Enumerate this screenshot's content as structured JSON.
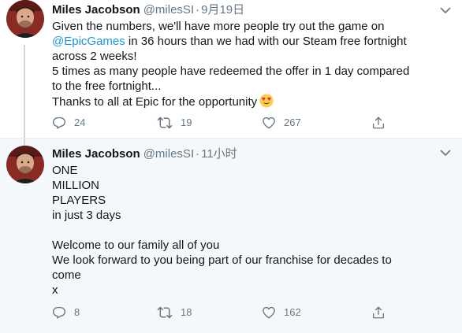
{
  "tweets": [
    {
      "author": {
        "name": "Miles Jacobson",
        "handle": "@milesSI"
      },
      "separator": "·",
      "time": "9月19日",
      "text_lines": [
        "Given the numbers, we'll have more people try out the game on",
        " in 36 hours than we had with our Steam free fortnight",
        "across 2 weeks!",
        "5 times as many people have redeemed the offer in 1 day compared",
        "to the free fortnight...",
        "Thanks to all at Epic for the opportunity"
      ],
      "mention": "@EpicGames",
      "emoji": "heart-eyes",
      "stats": {
        "replies": "24",
        "retweets": "19",
        "likes": "267"
      }
    },
    {
      "author": {
        "name": "Miles Jacobson",
        "handle": "@milesSI"
      },
      "separator": "·",
      "time": "11小时",
      "text_lines": [
        "ONE",
        "MILLION",
        "PLAYERS",
        "in just 3 days",
        "",
        "Welcome to our family all of you",
        "We look forward to you being part of our franchise for decades to",
        "come",
        "x"
      ],
      "stats": {
        "replies": "8",
        "retweets": "18",
        "likes": "162"
      }
    }
  ],
  "icons": {
    "reply": "reply-icon",
    "retweet": "retweet-icon",
    "like": "heart-icon",
    "share": "share-icon",
    "menu": "chevron-down-icon"
  },
  "colors": {
    "link": "#1b95e0",
    "secondary_text": "#657786",
    "thread_line": "#ccd6dd",
    "reply_background": "#f5f8fa"
  }
}
